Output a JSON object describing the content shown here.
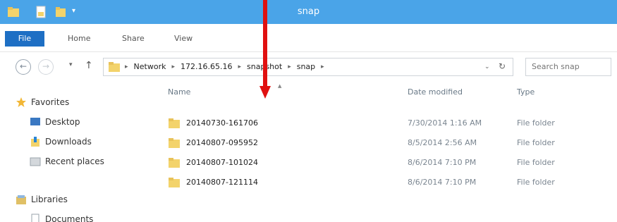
{
  "window": {
    "title": "snap"
  },
  "quick_access": {
    "chevron": "▾"
  },
  "ribbon": {
    "tabs": [
      "File",
      "Home",
      "Share",
      "View"
    ]
  },
  "nav_buttons": {
    "back": "←",
    "forward": "→",
    "recent": "▾",
    "up": "↑"
  },
  "address": {
    "crumbs": [
      "Network",
      "172.16.65.16",
      "snapshot",
      "snap"
    ],
    "separator": "▸",
    "dropdown": "⌄",
    "refresh": "↻"
  },
  "search": {
    "placeholder": "Search snap"
  },
  "nav_pane": {
    "favorites": "Favorites",
    "desktop": "Desktop",
    "downloads": "Downloads",
    "recent_places": "Recent places",
    "libraries": "Libraries",
    "documents": "Documents"
  },
  "columns": {
    "name": "Name",
    "date": "Date modified",
    "type": "Type",
    "sort_indicator": "▲"
  },
  "files": [
    {
      "name": "20140730-161706",
      "date": "7/30/2014 1:16 AM",
      "type": "File folder"
    },
    {
      "name": "20140807-095952",
      "date": "8/5/2014 2:56 AM",
      "type": "File folder"
    },
    {
      "name": "20140807-101024",
      "date": "8/6/2014 7:10 PM",
      "type": "File folder"
    },
    {
      "name": "20140807-121114",
      "date": "8/6/2014 7:10 PM",
      "type": "File folder"
    }
  ],
  "colors": {
    "titlebar": "#4aa4e8",
    "file_tab": "#1e6fc4",
    "folder": "#e8c25a",
    "annotation_arrow": "#e01010"
  }
}
